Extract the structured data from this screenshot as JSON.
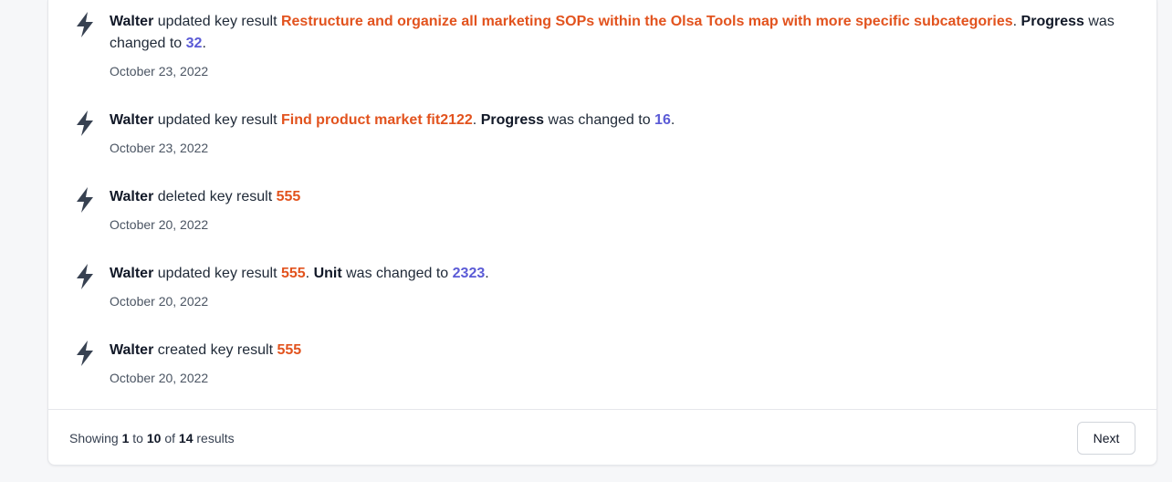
{
  "feed": {
    "items": [
      {
        "actor": "Walter",
        "verb": "updated key result",
        "target": "Restructure and organize all marketing SOPs within the Olsa Tools map with more specific subcategories",
        "field": "Progress",
        "change_text": "was changed to",
        "value": "32",
        "date": "October 23, 2022"
      },
      {
        "actor": "Walter",
        "verb": "updated key result",
        "target": "Find product market fit2122",
        "field": "Progress",
        "change_text": "was changed to",
        "value": "16",
        "date": "October 23, 2022"
      },
      {
        "actor": "Walter",
        "verb": "deleted key result",
        "target": "555",
        "date": "October 20, 2022"
      },
      {
        "actor": "Walter",
        "verb": "updated key result",
        "target": "555",
        "field": "Unit",
        "change_text": "was changed to",
        "value": "2323",
        "date": "October 20, 2022"
      },
      {
        "actor": "Walter",
        "verb": "created key result",
        "target": "555",
        "date": "October 20, 2022"
      }
    ],
    "icon": "lightning-bolt-icon"
  },
  "pagination": {
    "showing_label": "Showing",
    "from": "1",
    "to_label": "to",
    "to": "10",
    "of_label": "of",
    "total": "14",
    "results_label": "results",
    "next_label": "Next"
  },
  "colors": {
    "target": "#e2531e",
    "value": "#5b5bd6",
    "icon": "#374151"
  }
}
